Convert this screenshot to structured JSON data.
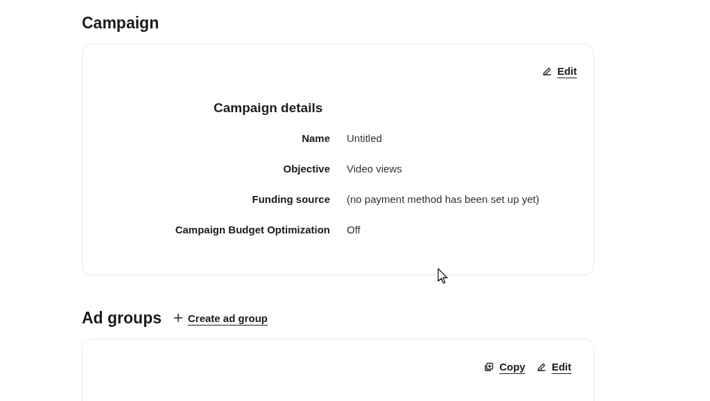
{
  "campaign": {
    "heading": "Campaign",
    "edit_label": "Edit",
    "details_title": "Campaign details",
    "fields": [
      {
        "label": "Name",
        "value": "Untitled"
      },
      {
        "label": "Objective",
        "value": "Video views"
      },
      {
        "label": "Funding source",
        "value": "(no payment method has been set up yet)"
      },
      {
        "label": "Campaign Budget Optimization",
        "value": "Off"
      }
    ]
  },
  "ad_groups": {
    "heading": "Ad groups",
    "create_label": "Create ad group",
    "actions": [
      {
        "kind": "copy",
        "label": "Copy"
      },
      {
        "kind": "edit",
        "label": "Edit"
      }
    ]
  }
}
